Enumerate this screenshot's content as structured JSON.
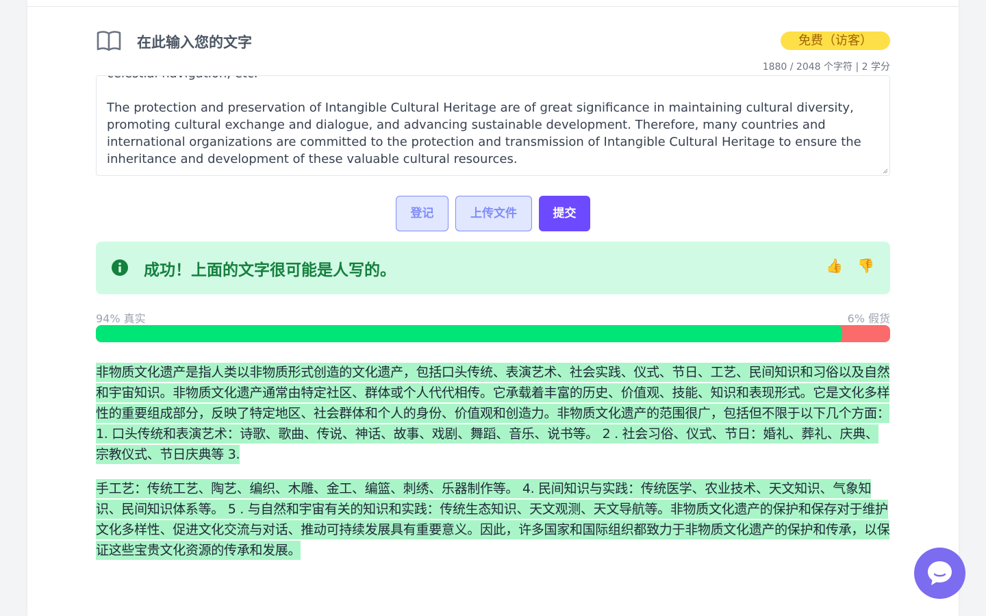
{
  "header": {
    "title": "在此输入您的文字",
    "plan_badge": "免费（访客）",
    "counter": "1880 / 2048 个字符 | 2 学分"
  },
  "input": {
    "text": "celestial navigation, etc.\n\nThe protection and preservation of Intangible Cultural Heritage are of great significance in maintaining cultural diversity, promoting cultural exchange and dialogue, and advancing sustainable development. Therefore, many countries and international organizations are committed to the protection and transmission of Intangible Cultural Heritage to ensure the inheritance and development of these valuable cultural resources."
  },
  "buttons": {
    "register": "登记",
    "upload": "上传文件",
    "submit": "提交"
  },
  "result": {
    "message": "成功！上面的文字很可能是人写的。",
    "thumbs_up": "👍",
    "thumbs_down": "👎"
  },
  "score": {
    "real_label": "94% 真实",
    "fake_label": "6% 假货",
    "real_fraction": 0.94
  },
  "output": {
    "paragraph1": "非物质文化遗产是指人类以非物质形式创造的文化遗产，包括口头传统、表演艺术、社会实践、仪式、节日、工艺、民间知识和习俗以及自然和宇宙知识。非物质文化遗产通常由特定社区、群体或个人代代相传。它承载着丰富的历史、价值观、技能、知识和表现形式。它是文化多样性的重要组成部分，反映了特定地区、社会群体和个人的身份、价值观和创造力。非物质文化遗产的范围很广，包括但不限于以下几个方面： 1. 口头传统和表演艺术：诗歌、歌曲、传说、神话、故事、戏剧、舞蹈、音乐、说书等。 2 . 社会习俗、仪式、节日：婚礼、葬礼、庆典、宗教仪式、节日庆典等 3.",
    "paragraph2": "手工艺：传统工艺、陶艺、编织、木雕、金工、编篮、刺绣、乐器制作等。 4. 民间知识与实践：传统医学、农业技术、天文知识、气象知识、民间知识体系等。 5 . 与自然和宇宙有关的知识和实践：传统生态知识、天文观测、天文导航等。非物质文化遗产的保护和保存对于维护文化多样性、促进文化交流与对话、推动可持续发展具有重要意义。因此，许多国家和国际组织都致力于非物质文化遗产的保护和传承，以保证这些宝贵文化资源的传承和发展。"
  },
  "colors": {
    "primary": "#6d4aff",
    "success_bg": "#d1fae5",
    "success_text": "#15803d",
    "real_bar": "#00e676",
    "fake_bar": "#fb6b6b",
    "highlight": "#aaf5c8"
  }
}
